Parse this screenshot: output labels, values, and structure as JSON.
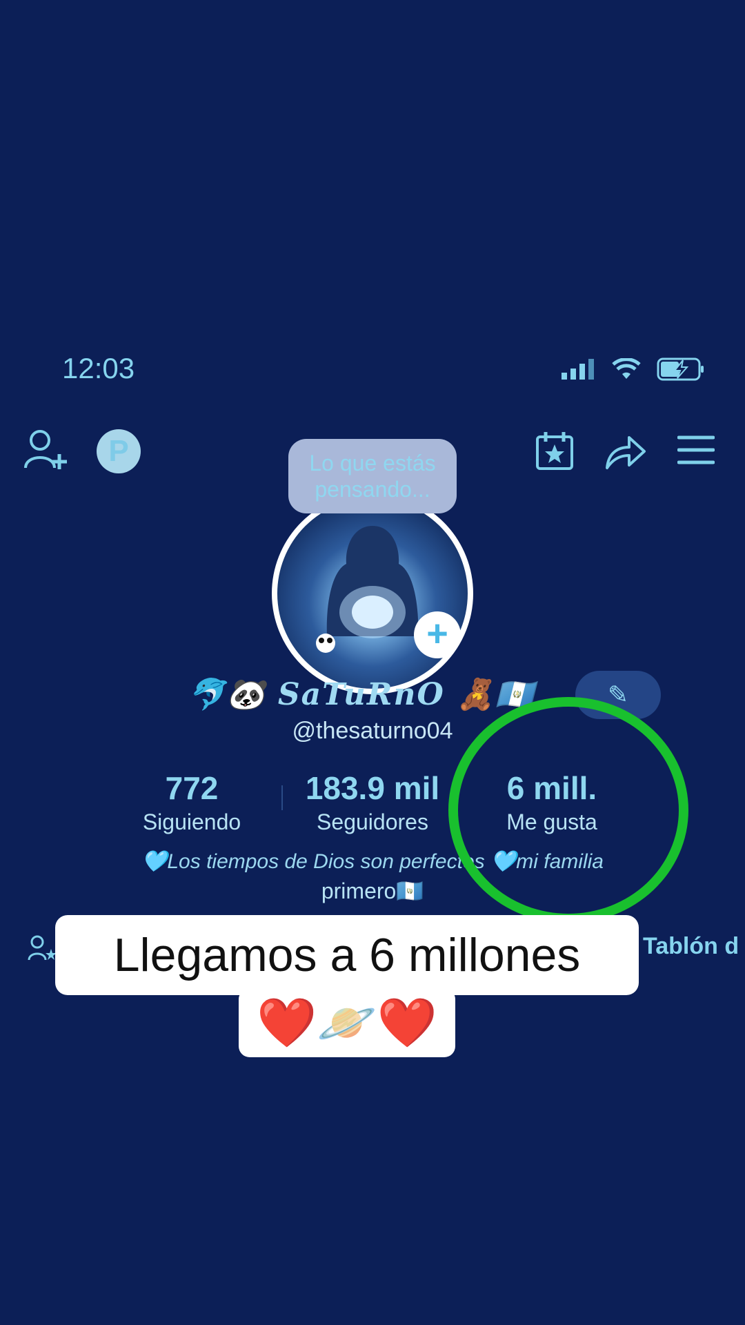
{
  "status_bar": {
    "time": "12:03"
  },
  "top_bar": {
    "add_friend_icon": "person-add-icon",
    "profile_p_icon": "P",
    "calendar_icon": "calendar-star-icon",
    "share_icon": "share-icon",
    "menu_icon": "menu-icon"
  },
  "avatar": {
    "bubble_text": "Lo que estás pensando..."
  },
  "profile": {
    "display_name": "SaTuRnO",
    "name_emojis_before": "🐬🐼",
    "name_emojis_after": "🧸🇬🇹",
    "handle": "@thesaturno04",
    "edit_icon": "pencil-icon"
  },
  "stats": [
    {
      "value": "772",
      "label": "Siguiendo"
    },
    {
      "value": "183.9 mil",
      "label": "Seguidores"
    },
    {
      "value": "6 mill.",
      "label": "Me gusta"
    }
  ],
  "bio": {
    "line1": "🩵Los tiempos de Dios son perfectos 🩵mi familia",
    "line2": "primero🇬🇹"
  },
  "tabs": {
    "tablon": "Tablón d"
  },
  "overlay": {
    "line1": "Llegamos a 6 millones",
    "line2": "❤️🪐❤️"
  },
  "colors": {
    "background": "#0c1f57",
    "accent": "#7fd0ea",
    "highlight_ring": "#19c02e"
  }
}
